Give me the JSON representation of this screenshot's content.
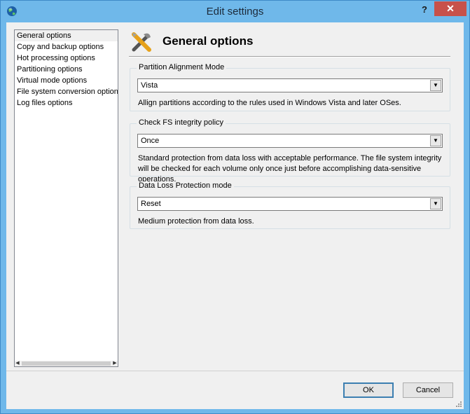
{
  "window": {
    "title": "Edit settings",
    "help": "?",
    "close": "✕"
  },
  "sidebar": {
    "items": [
      {
        "label": "General options"
      },
      {
        "label": "Copy and backup options"
      },
      {
        "label": "Hot processing options"
      },
      {
        "label": "Partitioning options"
      },
      {
        "label": "Virtual mode options"
      },
      {
        "label": "File system conversion options"
      },
      {
        "label": "Log files options"
      }
    ],
    "selected": "General options"
  },
  "main": {
    "title": "General options",
    "groups": [
      {
        "legend": "Partition Alignment Mode",
        "value": "Vista",
        "description": "Allign partitions according to the rules used in Windows Vista and later OSes."
      },
      {
        "legend": "Check FS integrity policy",
        "value": "Once",
        "description": "Standard protection from data loss with acceptable performance. The file system integrity will be checked for each volume only once just before accomplishing data-sensitive operations."
      },
      {
        "legend": "Data Loss Protection mode",
        "value": "Reset",
        "description": "Medium protection from data loss."
      }
    ]
  },
  "footer": {
    "ok": "OK",
    "cancel": "Cancel"
  },
  "icons": {
    "app": "globe-icon",
    "header": "tools-icon",
    "dropdown": "chevron-down-icon"
  },
  "colors": {
    "titlebar": "#6fb8ea",
    "close": "#c7514a",
    "selection": "#f0f0f0",
    "default_button_border": "#3c7fb1"
  }
}
